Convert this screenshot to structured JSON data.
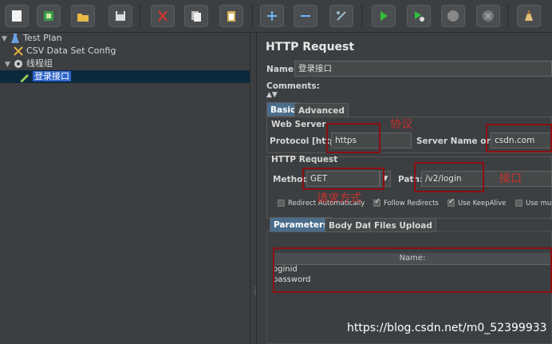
{
  "toolbar": {
    "buttons": [
      {
        "name": "new-icon"
      },
      {
        "name": "templates-icon"
      },
      {
        "name": "open-icon"
      },
      {
        "name": "save-icon"
      },
      {
        "name": "cut-icon"
      },
      {
        "name": "copy-icon"
      },
      {
        "name": "paste-icon"
      },
      {
        "name": "expand-icon"
      },
      {
        "name": "collapse-icon"
      },
      {
        "name": "toggle-icon"
      },
      {
        "name": "start-icon"
      },
      {
        "name": "start-no-pauses-icon"
      },
      {
        "name": "stop-icon"
      },
      {
        "name": "shutdown-icon"
      },
      {
        "name": "clear-icon"
      }
    ]
  },
  "tree": {
    "test_plan": "Test Plan",
    "csv_config": "CSV Data Set Config",
    "thread_group": "线程组",
    "sampler": "登录接口"
  },
  "panel": {
    "title": "HTTP Request",
    "name_label": "Name:",
    "name_value": "登录接口",
    "comments_label": "Comments:",
    "tabs": [
      "Basic",
      "Advanced"
    ],
    "web_server_label": "Web Server",
    "protocol_label": "Protocol [http]:",
    "protocol_value": "https",
    "server_label": "Server Name or IP",
    "server_value": "csdn.com",
    "http_request_label": "HTTP Request",
    "method_label": "Method",
    "method_value": "GET",
    "path_label": "Path:",
    "path_value": "/v2/login",
    "checkboxes": [
      {
        "label": "Redirect Automatically",
        "checked": false
      },
      {
        "label": "Follow Redirects",
        "checked": true
      },
      {
        "label": "Use KeepAlive",
        "checked": true
      },
      {
        "label": "Use mu",
        "checked": false
      }
    ],
    "param_tabs": [
      "Parameters",
      "Body Data",
      "Files Upload"
    ],
    "table_header": "Name:",
    "rows": [
      "oginid",
      "password"
    ]
  },
  "annotations": {
    "protocol": "协议",
    "method": "请求方式",
    "path": "接口"
  },
  "watermark": "https://blog.csdn.net/m0_52399933",
  "colors": {
    "annotation": "#c9302c",
    "selection": "#2f65ca",
    "background": "#3c3f41"
  }
}
